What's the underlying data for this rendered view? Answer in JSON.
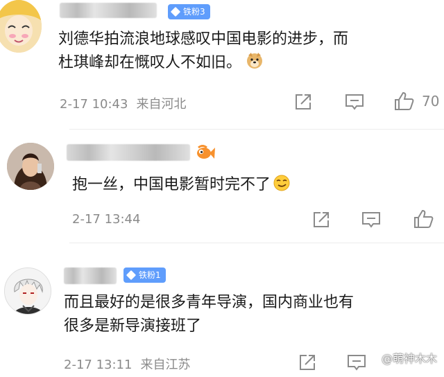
{
  "comments": [
    {
      "badge": "铁粉3",
      "text_line1": "刘德华拍流浪地球感叹中国电影的进步，而",
      "text_line2": "杜琪峰却在慨叹人不如旧。",
      "emoji": "doge-emoji",
      "time": "2-17 10:43",
      "location": "来自河北",
      "likes": "70"
    },
    {
      "badge": "",
      "text_line1": "抱一丝，中国电影暂时完不了",
      "emoji": "smirk-emoji",
      "time": "2-17 13:44",
      "location": "",
      "likes": ""
    },
    {
      "badge": "铁粉1",
      "text_line1": "而且最好的是很多青年导演，国内商业也有",
      "text_line2": "很多是新导演接班了",
      "time": "2-17 13:11",
      "location": "来自江苏",
      "likes": ""
    }
  ],
  "watermark": "@萌神木木",
  "icons": {
    "share": "share-icon",
    "comment": "comment-icon",
    "like": "thumbs-up-icon",
    "badge_gem": "diamond-icon",
    "fish": "fish-emoji"
  },
  "colors": {
    "badge_blue": "#5f9dfc",
    "meta_gray": "#8a8a8a"
  }
}
